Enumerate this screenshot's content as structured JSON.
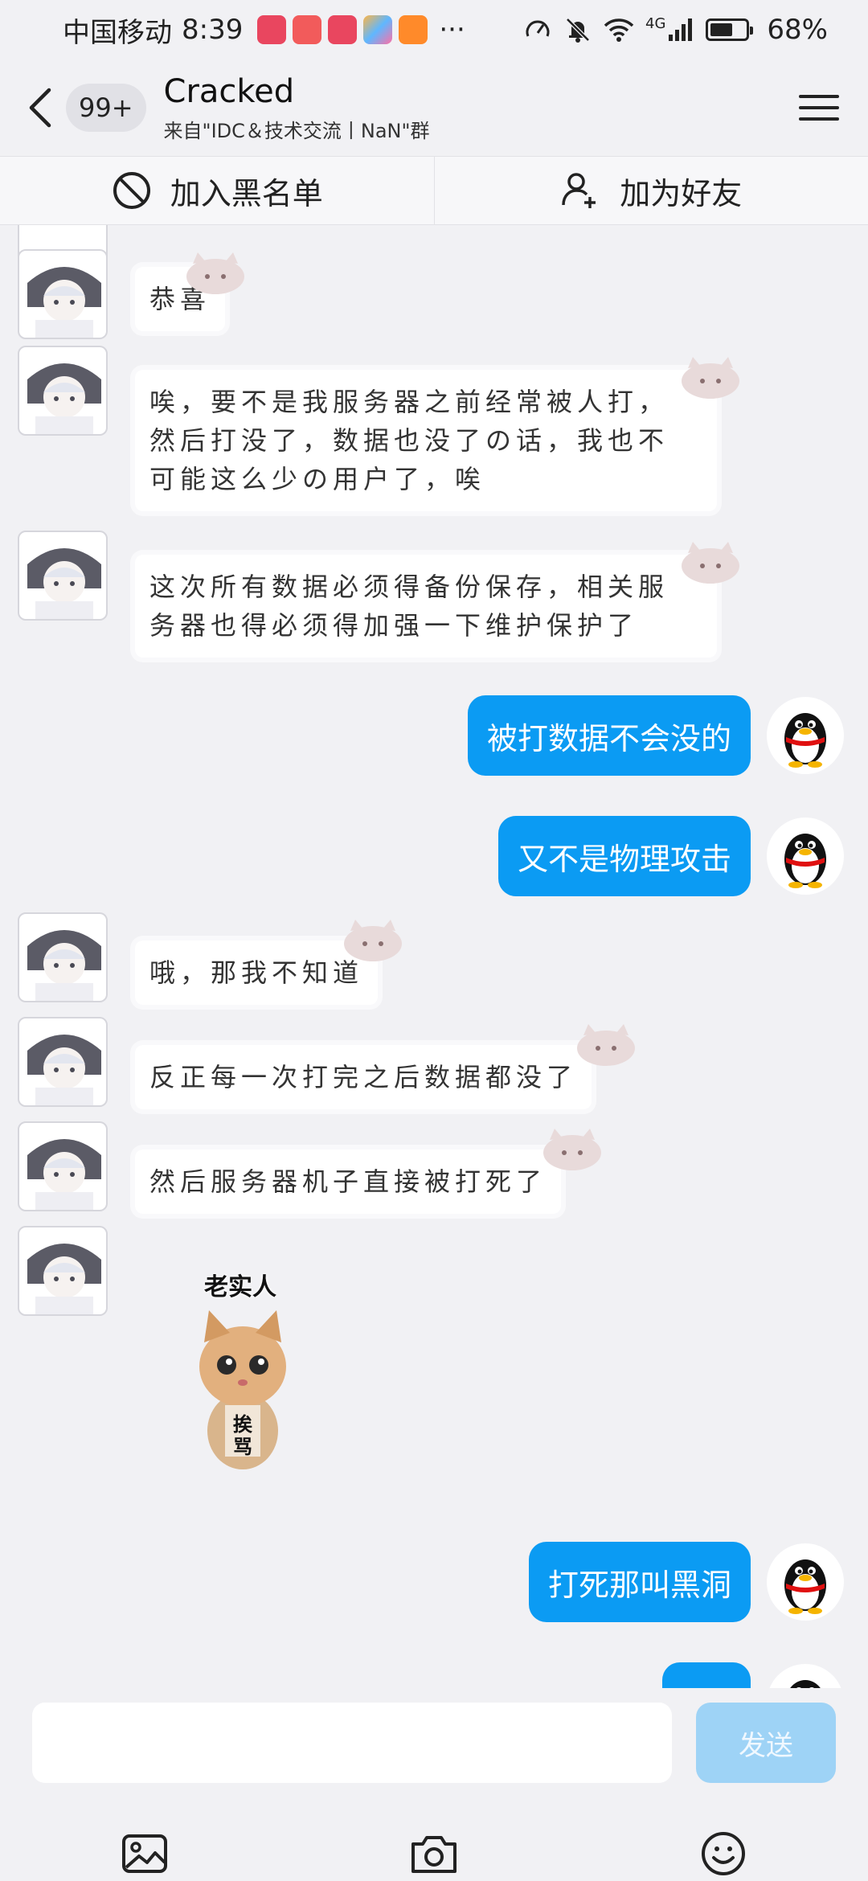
{
  "status_bar": {
    "carrier": "中国移动",
    "time": "8:39",
    "more": "···",
    "network": "4G",
    "battery": "68%",
    "battery_level": 0.68
  },
  "header": {
    "unread_badge": "99+",
    "title": "Cracked",
    "subtitle": "来自\"IDC＆技术交流丨NaN\"群"
  },
  "actions": {
    "block_label": "加入黑名单",
    "add_friend_label": "加为好友"
  },
  "messages": [
    {
      "side": "left",
      "text": "恭喜"
    },
    {
      "side": "left",
      "lines": [
        "唉，要不是我服务器之前经常被人打，",
        "然后打没了，数据也没了の话，我也不",
        "可能这么少の用户了，唉"
      ]
    },
    {
      "side": "left",
      "lines": [
        "这次所有数据必须得备份保存，相关服",
        "务器也得必须得加强一下维护保护了"
      ]
    },
    {
      "side": "right",
      "text": "被打数据不会没的"
    },
    {
      "side": "right",
      "text": "又不是物理攻击"
    },
    {
      "side": "left",
      "text": "哦，那我不知道"
    },
    {
      "side": "left",
      "text": "反正每一次打完之后数据都没了"
    },
    {
      "side": "left",
      "text": "然后服务器机子直接被打死了"
    },
    {
      "side": "left",
      "sticker": {
        "top_text": "老实人",
        "body_text": "挨骂"
      }
    },
    {
      "side": "right",
      "text": "打死那叫黑洞"
    }
  ],
  "input": {
    "placeholder": "",
    "send_label": "发送"
  },
  "colors": {
    "accent": "#0b9bf3",
    "send_disabled": "#9ed3f6",
    "background": "#f1f1f4"
  }
}
